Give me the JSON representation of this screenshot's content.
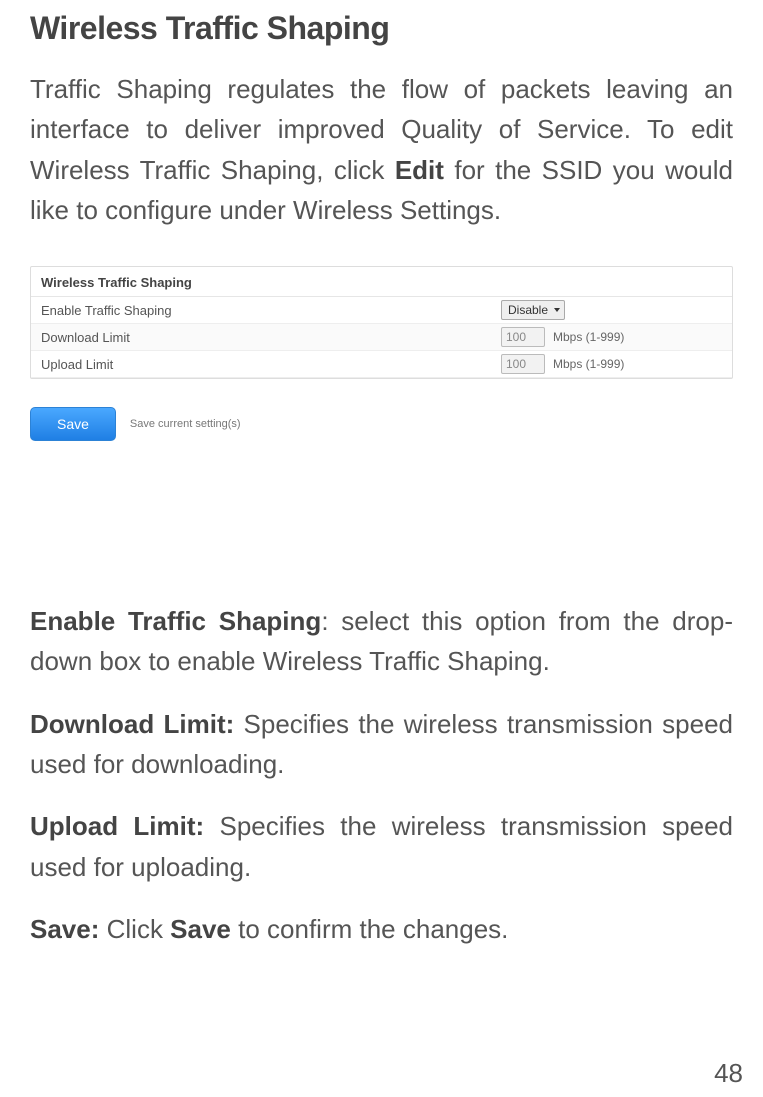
{
  "heading": "Wireless Traffic Shaping",
  "intro": {
    "part1": "Traffic Shaping regulates the flow of packets leaving an interface to deliver improved Quality of Service. To edit Wireless Traffic Shaping, click ",
    "bold1": "Edit",
    "part2": " for the SSID you would like to configure under Wireless Settings."
  },
  "panel": {
    "title": "Wireless Traffic Shaping",
    "rows": {
      "enable": {
        "label": "Enable Traffic Shaping",
        "value": "Disable"
      },
      "download": {
        "label": "Download Limit",
        "value": "100",
        "unit": "Mbps (1-999)"
      },
      "upload": {
        "label": "Upload Limit",
        "value": "100",
        "unit": "Mbps (1-999)"
      }
    },
    "save_label": "Save",
    "save_hint": "Save current setting(s)"
  },
  "defs": {
    "enable": {
      "term": "Enable Traffic Shaping",
      "text": ": select this option from the drop-down box to enable Wireless Traffic Shaping."
    },
    "download": {
      "term": "Download Limit:",
      "text": " Specifies the wireless transmission speed used for downloading."
    },
    "upload": {
      "term": "Upload Limit:",
      "text": " Specifies the wireless transmission speed used for uploading."
    },
    "save": {
      "term": "Save:",
      "text1": " Click ",
      "bold": "Save",
      "text2": " to confirm the changes."
    }
  },
  "page_number": "48"
}
